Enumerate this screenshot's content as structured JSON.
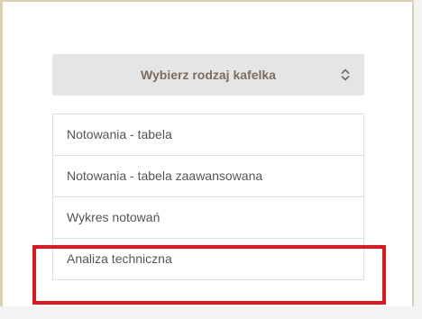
{
  "tile_select": {
    "placeholder": "Wybierz rodzaj kafelka",
    "arrow_icon": "chevron-up-down-icon"
  },
  "tile_options": [
    {
      "label": "Notowania - tabela"
    },
    {
      "label": "Notowania - tabela zaawansowana"
    },
    {
      "label": "Wykres notowań"
    },
    {
      "label": "Analiza techniczna"
    }
  ],
  "highlight": {
    "target": "Analiza techniczna",
    "color": "#e2141e"
  },
  "colors": {
    "select_background": "#e5e5e5",
    "select_text": "#7d6d5c",
    "panel_border": "#d9cfb2"
  }
}
